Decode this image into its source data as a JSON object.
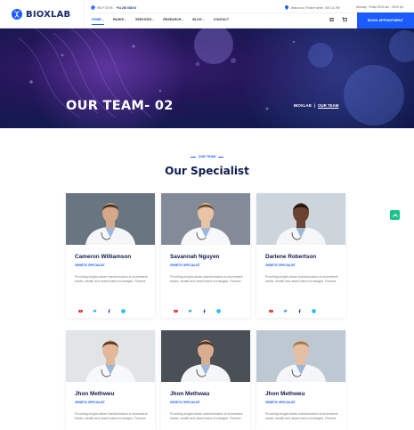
{
  "brand": {
    "name": "BIOXLAB"
  },
  "topbar": {
    "help_label": "HELP DESK :",
    "help_phone": "+01 230 038 03",
    "address": "Jessica sor, Fishner street, 345 CA 789",
    "hours": "Monday - Friday 09:00 am - 05:00 pm"
  },
  "nav": [
    {
      "label": "Home",
      "dropdown": true,
      "active": true
    },
    {
      "label": "Pages",
      "dropdown": true,
      "active": false
    },
    {
      "label": "Services",
      "dropdown": true,
      "active": false
    },
    {
      "label": "Research",
      "dropdown": true,
      "active": false
    },
    {
      "label": "Blog",
      "dropdown": true,
      "active": false
    },
    {
      "label": "Contact",
      "dropdown": false,
      "active": false
    }
  ],
  "header": {
    "book_label": "BOOK APPOINTMENT",
    "cart_icon": "cart-icon",
    "menu_icon": "hamburger-icon"
  },
  "hero": {
    "title": "OUR TEAM- 02",
    "breadcrumb_home": "BIOXLAB",
    "breadcrumb_sep": "|",
    "breadcrumb_current": "OUR TEAM"
  },
  "section": {
    "eyebrow": "OUR TEAM",
    "title": "Our Specialist"
  },
  "team": [
    {
      "name": "Cameron Williamson",
      "role": "GENETIC SPECIALIST",
      "desc": "Providing insight-driven transformation to investment banks, wealth and asset mana exchanges. Finance",
      "skin": "#d5a889",
      "hair": "#4a3322",
      "coat": "#f4f6f8",
      "bg": "#5e6a78"
    },
    {
      "name": "Savannah Nguyen",
      "role": "GENETIC SPECIALIST",
      "desc": "Providing insight-driven transformation to investment banks, wealth and asset mana exchanges. Finance",
      "skin": "#e8c3a6",
      "hair": "#6b4a2d",
      "coat": "#f6f8fa",
      "bg": "#7a8290"
    },
    {
      "name": "Darlene Robertson",
      "role": "GENETIC SPECIALIST",
      "desc": "Providing insight-driven transformation to investment banks, wealth and asset mana exchanges. Finance",
      "skin": "#6a4430",
      "hair": "#1d140e",
      "coat": "#f4f6f8",
      "bg": "#c9d2da"
    },
    {
      "name": "Jhon Methweu",
      "role": "GENETIC SPECIALIST",
      "desc": "Providing insight-driven transformation to investment banks, wealth and asset mana exchanges. Finance",
      "skin": "#e2b899",
      "hair": "#5a3a26",
      "coat": "#f6f8fa",
      "bg": "#dfe3e6"
    },
    {
      "name": "Jhon Methwau",
      "role": "GENETIC SPECIALIST",
      "desc": "Providing insight-driven transformation to investment banks, wealth and asset mana exchanges. Finance",
      "skin": "#d9ad8f",
      "hair": "#4d3423",
      "coat": "#f4f6f8",
      "bg": "#3c4248"
    },
    {
      "name": "Jhon Methweu",
      "role": "GENETIC SPECIALIST",
      "desc": "Providing insight-driven transformation to investment banks, wealth and asset mana exchanges. Finance",
      "skin": "#e6bea1",
      "hair": "#9a7a55",
      "coat": "#f4f6f8",
      "bg": "#b8c4cf"
    }
  ],
  "social_icons": [
    "youtube-icon",
    "twitter-icon",
    "facebook-icon",
    "skype-icon"
  ],
  "colors": {
    "accent": "#1a5cff",
    "navy": "#0e1b4d",
    "hero": "#1b1a5e",
    "float": "#18c48a"
  }
}
